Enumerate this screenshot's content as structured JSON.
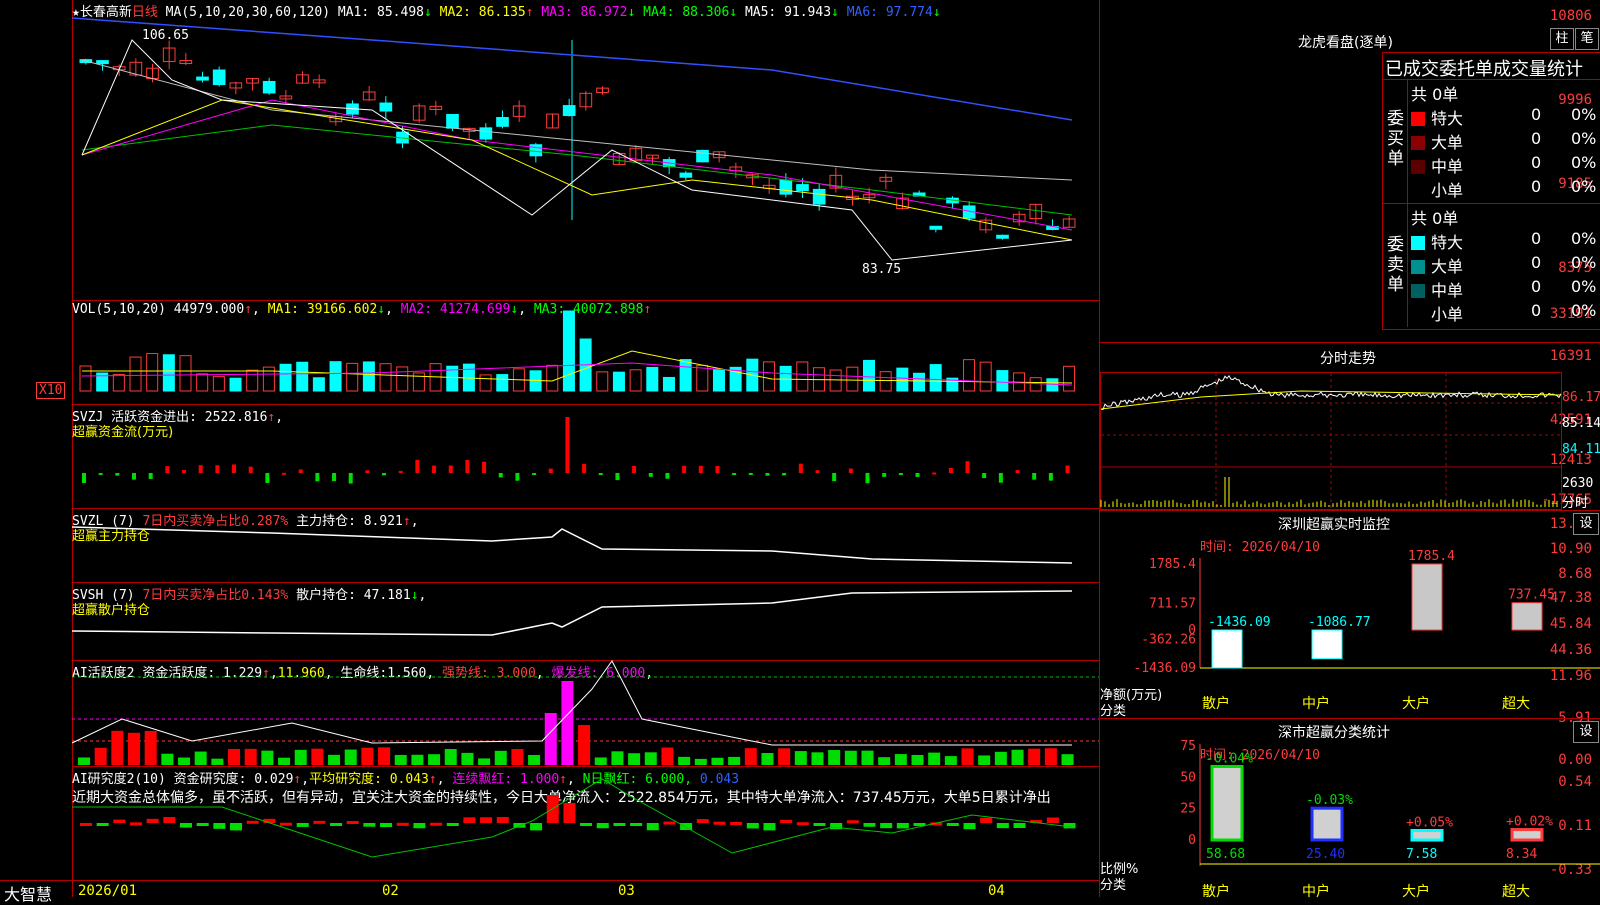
{
  "app": {
    "brand": "大智慧"
  },
  "main": {
    "stock": "★长春高新",
    "period": "日线",
    "ma_header": "MA(5,10,20,30,60,120)",
    "ma_values": [
      {
        "label": "MA1:",
        "value": "85.498",
        "dir": "↓"
      },
      {
        "label": "MA2:",
        "value": "86.135",
        "dir": "↑"
      },
      {
        "label": "MA3:",
        "value": "86.972",
        "dir": "↓"
      },
      {
        "label": "MA4:",
        "value": "88.306",
        "dir": "↓"
      },
      {
        "label": "MA5:",
        "value": "91.943",
        "dir": "↓"
      },
      {
        "label": "MA6:",
        "value": "97.774",
        "dir": "↓"
      }
    ],
    "y_ticks": [
      "10806",
      "9996",
      "9185",
      "8375"
    ],
    "high_label": "106.65",
    "low_label": "83.75",
    "x_ticks": [
      "2026/01",
      "02",
      "03",
      "04"
    ]
  },
  "vol": {
    "header": "VOL(5,10,20)",
    "value": "44979.000",
    "ma1": "39166.602",
    "ma2": "41274.699",
    "ma3": "40072.898",
    "y_ticks": [
      "33191",
      "16391"
    ],
    "unit": "X10"
  },
  "svzj": {
    "header": "SVZJ",
    "label": "活跃资金进出:",
    "value": "2522.816",
    "subtitle": "超赢资金流(万元)",
    "y_ticks": [
      "42591",
      "12413",
      "-17765"
    ]
  },
  "svzl": {
    "header": "SVZL (7)",
    "label1": "7日内买卖净占比0.287%",
    "label2": "主力持仓:",
    "value": "8.921",
    "subtitle": "超赢主力持仓",
    "y_ticks": [
      "13.13",
      "10.90",
      "8.68"
    ]
  },
  "svsh": {
    "header": "SVSH (7)",
    "label1": "7日内买卖净占比0.143%",
    "label2": "散户持仓:",
    "value": "47.181",
    "subtitle": "超赢散户持仓",
    "y_ticks": [
      "47.38",
      "45.84",
      "44.36"
    ]
  },
  "ai2": {
    "header": "AI活跃度2",
    "label": "资金活跃度:",
    "value": "1.229",
    "v2": "11.960",
    "life_label": "生命线:",
    "life": "1.560",
    "strong": "强势线: 3.000",
    "burst": "爆发线: 6.000",
    "y_ticks": [
      "11.96",
      "5.91",
      "0.00"
    ]
  },
  "research": {
    "header": "AI研究度2(10)",
    "label": "资金研究度:",
    "value": "0.029",
    "avg": "平均研究度: 0.043",
    "red": "连续飘红: 1.000",
    "nday": "N日飘红: 6.000,",
    "nday2": "0.043",
    "comment": "近期大资金总体偏多，虽不活跃，但有异动，宜关注大资金的持续性，今日大单净流入：2522.854万元，其中特大单净流入：737.45万元，大单5日累计净出",
    "y_ticks": [
      "0.54",
      "0.11",
      "-0.33"
    ]
  },
  "dragon": {
    "title": "龙虎看盘(逐单)",
    "btn1": "柱",
    "btn2": "笔",
    "stats_title": "已成交委托单成交量统计",
    "buy_label": "委买单",
    "sell_label": "委卖单",
    "buy_total": "共 0单",
    "sell_total": "共 0单",
    "buy_rows": [
      {
        "name": "特大",
        "n": "0",
        "p": "0%",
        "color": "#ff0000"
      },
      {
        "name": "大单",
        "n": "0",
        "p": "0%",
        "color": "#8b0000"
      },
      {
        "name": "中单",
        "n": "0",
        "p": "0%",
        "color": "#5a0000"
      },
      {
        "name": "小单",
        "n": "0",
        "p": "0%",
        "color": "#000000"
      }
    ],
    "sell_rows": [
      {
        "name": "特大",
        "n": "0",
        "p": "0%",
        "color": "#00ffff"
      },
      {
        "name": "大单",
        "n": "0",
        "p": "0%",
        "color": "#009090"
      },
      {
        "name": "中单",
        "n": "0",
        "p": "0%",
        "color": "#006060"
      },
      {
        "name": "小单",
        "n": "0",
        "p": "0%",
        "color": "#000000"
      }
    ]
  },
  "intraday": {
    "title": "分时走势",
    "y_ticks": [
      "86.17",
      "85.14",
      "84.11"
    ],
    "vol_tick": "2630",
    "vol_label": "分时"
  },
  "sz_monitor": {
    "title": "深圳超赢实时监控",
    "btn": "设",
    "date_label": "时间:",
    "date": "2026/04/10",
    "y_ticks": [
      "1785.4",
      "711.57",
      "0",
      "-362.26",
      "-1436.09"
    ],
    "ylabel": "净额(万元)",
    "xlabel": "分类"
  },
  "sz_class": {
    "title": "深市超赢分类统计",
    "btn": "设",
    "date_label": "时间:",
    "date": "2026/04/10",
    "y_ticks": [
      "75",
      "50",
      "25",
      "0"
    ],
    "ylabel": "比例%",
    "xlabel": "分类"
  },
  "chart_data": [
    {
      "type": "bar",
      "title": "深圳超赢实时监控",
      "categories": [
        "散户",
        "中户",
        "大户",
        "超大"
      ],
      "values": [
        -1436.09,
        -1086.77,
        1785.4,
        737.45
      ],
      "ylabel": "净额(万元)",
      "xlabel": "分类",
      "ylim": [
        -1436.09,
        1785.4
      ]
    },
    {
      "type": "bar",
      "title": "深市超赢分类统计",
      "categories": [
        "散户",
        "中户",
        "大户",
        "超大"
      ],
      "values": [
        58.68,
        25.4,
        7.58,
        8.34
      ],
      "changes": [
        "-0.04%",
        "-0.03%",
        "+0.05%",
        "+0.02%"
      ],
      "ylabel": "比例%",
      "xlabel": "分类",
      "ylim": [
        0,
        75
      ]
    }
  ]
}
